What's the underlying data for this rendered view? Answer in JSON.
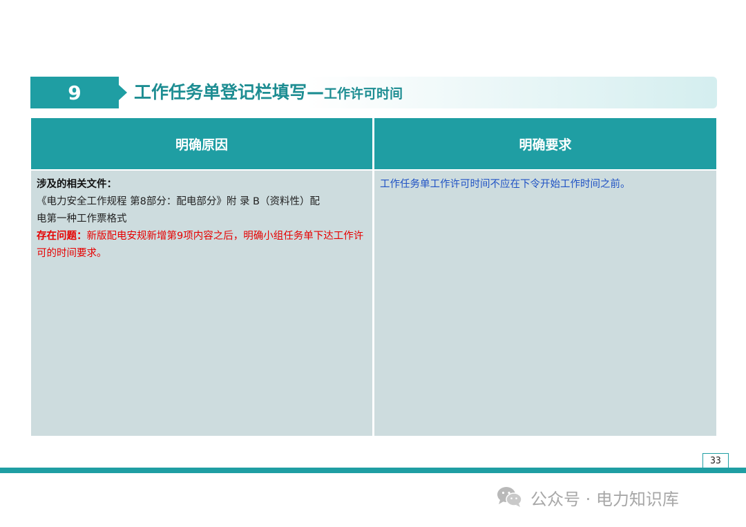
{
  "section": {
    "number": "9",
    "title": "工作任务单登记栏填写—",
    "subtitle": "工作许可时间"
  },
  "table": {
    "headers": [
      "明确原因",
      "明确要求"
    ],
    "reason": {
      "docs_label": "涉及的相关文件：",
      "docs_text_line1": "《电力安全工作规程  第8部分：配电部分》附 录 B（资料性）配",
      "docs_text_line2": "电第一种工作票格式",
      "issue_label": "存在问题：",
      "issue_text": "新版配电安规新增第9项内容之后，明确小组任务单下达工作许可的时间要求。"
    },
    "requirement": {
      "text": "工作任务单工作许可时间不应在下令开始工作时间之前。"
    }
  },
  "footer": {
    "page_number": "33",
    "watermark_text": "公众号 · 电力知识库",
    "watermark_icon": "wechat-icon"
  },
  "colors": {
    "accent": "#1f9ea3",
    "cell_bg": "#cddcde",
    "issue_red": "#e60000",
    "requirement_blue": "#1f52c4",
    "watermark_gray": "#a7a7a7"
  }
}
